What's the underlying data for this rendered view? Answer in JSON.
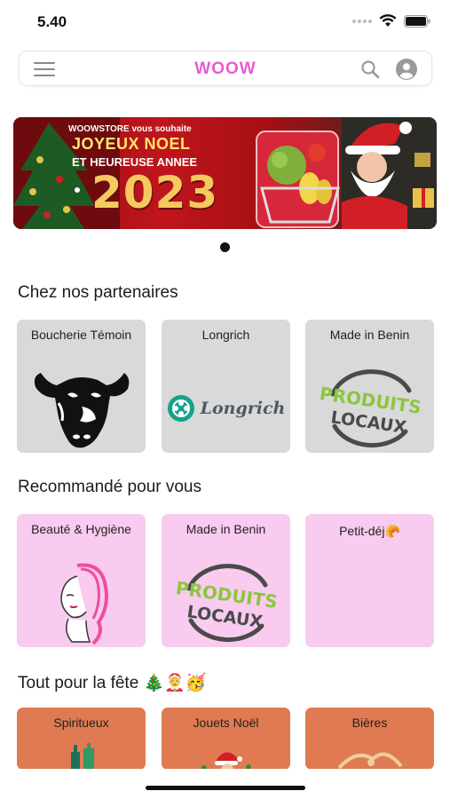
{
  "status_bar": {
    "time": "5.40"
  },
  "header": {
    "title": "WOOW"
  },
  "banner": {
    "line1": "WOOWSTORE vous souhaite",
    "line2": "JOYEUX NOEL",
    "line3": "ET HEUREUSE ANNEE",
    "year": "2023"
  },
  "sections": [
    {
      "title": "Chez nos partenaires",
      "cards": [
        {
          "label": "Boucherie Témoin",
          "image": "cow-head-logo"
        },
        {
          "label": "Longrich",
          "image": "longrich-logo",
          "logo_text": "Longrich"
        },
        {
          "label": "Made in Benin",
          "image": "produits-locaux-stamp",
          "stamp_line1": "PRODUITS",
          "stamp_line2": "LOCAUX"
        }
      ]
    },
    {
      "title": "Recommandé pour vous",
      "cards": [
        {
          "label": "Beauté & Hygiène",
          "image": "woman-face-illustration"
        },
        {
          "label": "Made in Benin",
          "image": "produits-locaux-stamp",
          "stamp_line1": "PRODUITS",
          "stamp_line2": "LOCAUX"
        },
        {
          "label": "Petit-déj🥐",
          "image": ""
        }
      ]
    },
    {
      "title": "Tout pour la fête 🎄🤶🥳",
      "cards": [
        {
          "label": "Spiritueux",
          "image": "bottles"
        },
        {
          "label": "Jouets Noël",
          "image": "santa-toy"
        },
        {
          "label": "Bières",
          "image": "beer-splash"
        }
      ]
    }
  ],
  "colors": {
    "brand": "#e85bd3",
    "card_grey": "#d9d9d9",
    "card_pink": "#f9cbee",
    "card_orange": "#e07a52"
  }
}
